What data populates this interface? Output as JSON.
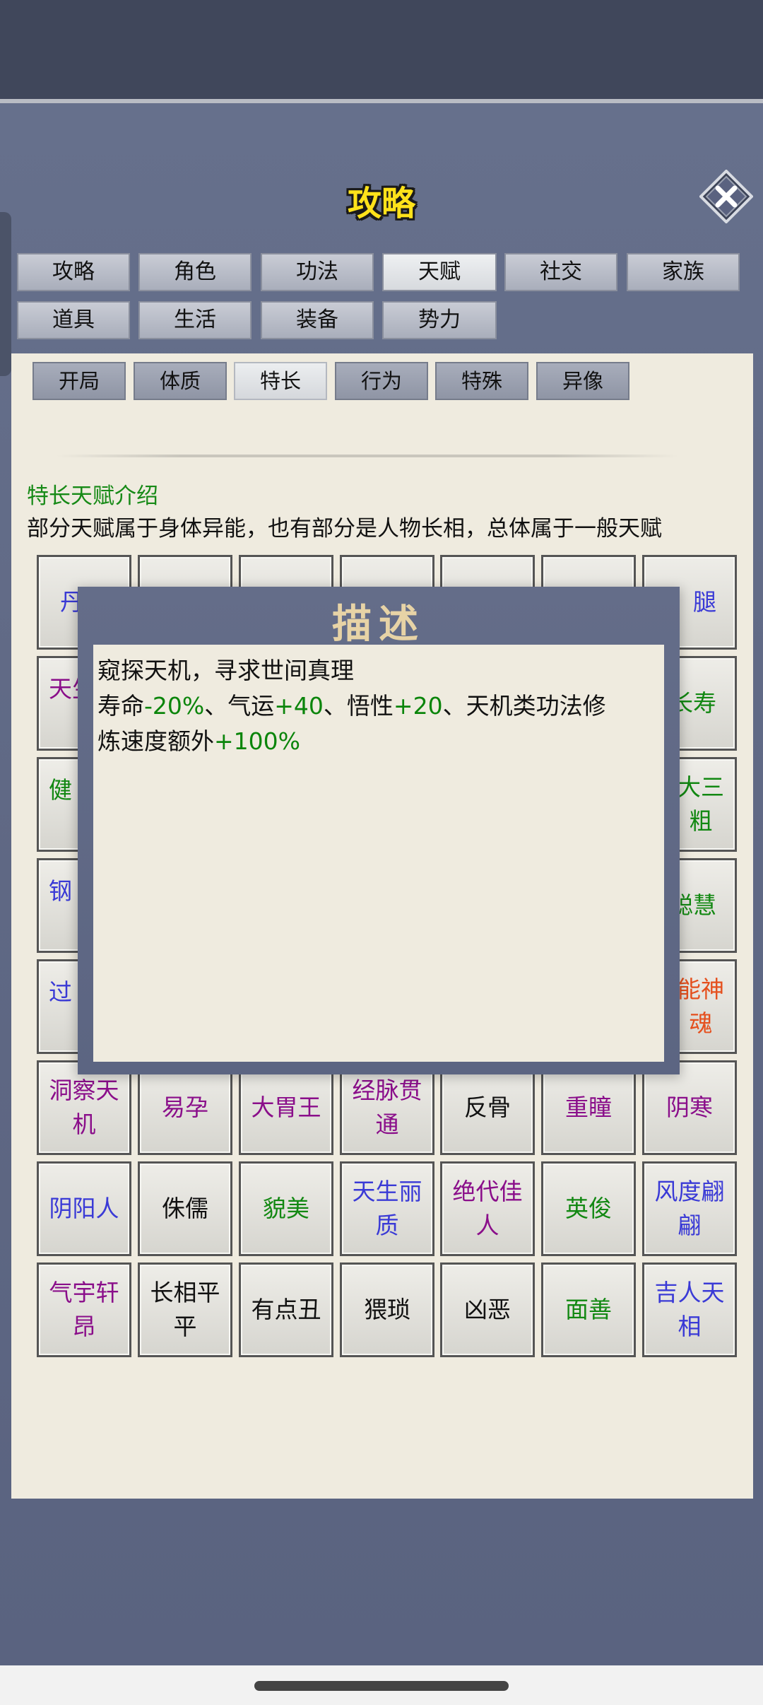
{
  "header": {
    "title": "攻略"
  },
  "tabs_row1": [
    {
      "label": "攻略",
      "active": false
    },
    {
      "label": "角色",
      "active": false
    },
    {
      "label": "功法",
      "active": false
    },
    {
      "label": "天赋",
      "active": true
    },
    {
      "label": "社交",
      "active": false
    },
    {
      "label": "家族",
      "active": false
    }
  ],
  "tabs_row2": [
    {
      "label": "道具",
      "active": false
    },
    {
      "label": "生活",
      "active": false
    },
    {
      "label": "装备",
      "active": false
    },
    {
      "label": "势力",
      "active": false
    }
  ],
  "subtabs": [
    {
      "label": "开局",
      "active": false
    },
    {
      "label": "体质",
      "active": false
    },
    {
      "label": "特长",
      "active": true
    },
    {
      "label": "行为",
      "active": false
    },
    {
      "label": "特殊",
      "active": false
    },
    {
      "label": "异像",
      "active": false
    }
  ],
  "section": {
    "title": "特长天赋介绍",
    "description": "部分天赋属于身体异能，也有部分是人物长相，总体属于一般天赋"
  },
  "talents_partial": [
    {
      "label": "丹",
      "color": "#3a3ad6"
    },
    {
      "label": "腿",
      "color": "#3a3ad6"
    },
    {
      "label": "天生",
      "color": "#8a0e8a"
    },
    {
      "label": "长寿",
      "color": "#128812"
    },
    {
      "label": "健",
      "color": "#128812"
    },
    {
      "label": "大三粗",
      "color": "#128812"
    },
    {
      "label": "钢",
      "color": "#3a3ad6"
    },
    {
      "label": "聪慧",
      "color": "#128812"
    },
    {
      "label": "过",
      "color": "#3a3ad6"
    },
    {
      "label": "能神魂",
      "color": "#e5501e"
    }
  ],
  "talents": [
    {
      "label": "洞察天机",
      "color": "#8a0e8a"
    },
    {
      "label": "易孕",
      "color": "#8a0e8a"
    },
    {
      "label": "大胃王",
      "color": "#8a0e8a"
    },
    {
      "label": "经脉贯通",
      "color": "#8a0e8a"
    },
    {
      "label": "反骨",
      "color": "#111111"
    },
    {
      "label": "重瞳",
      "color": "#8a0e8a"
    },
    {
      "label": "阴寒",
      "color": "#8a0e8a"
    },
    {
      "label": "阴阳人",
      "color": "#3a3ad6"
    },
    {
      "label": "侏儒",
      "color": "#111111"
    },
    {
      "label": "貌美",
      "color": "#128812"
    },
    {
      "label": "天生丽质",
      "color": "#3a3ad6"
    },
    {
      "label": "绝代佳人",
      "color": "#8a0e8a"
    },
    {
      "label": "英俊",
      "color": "#128812"
    },
    {
      "label": "风度翩翩",
      "color": "#3a3ad6"
    },
    {
      "label": "气宇轩昂",
      "color": "#8a0e8a"
    },
    {
      "label": "长相平平",
      "color": "#111111"
    },
    {
      "label": "有点丑",
      "color": "#111111"
    },
    {
      "label": "猥琐",
      "color": "#111111"
    },
    {
      "label": "凶恶",
      "color": "#111111"
    },
    {
      "label": "面善",
      "color": "#128812"
    },
    {
      "label": "吉人天相",
      "color": "#3a3ad6"
    }
  ],
  "modal": {
    "title": "描述",
    "line1": "窥探天机，寻求世间真理",
    "l2_a": "寿命",
    "l2_b": "-20%",
    "l2_c": "、气运",
    "l2_d": "+40",
    "l2_e": "、悟性",
    "l2_f": "+20",
    "l2_g": "、天机类功法修",
    "l3_a": "炼速度额外",
    "l3_b": "+100%"
  },
  "icons": {
    "close": "close-x-icon"
  }
}
